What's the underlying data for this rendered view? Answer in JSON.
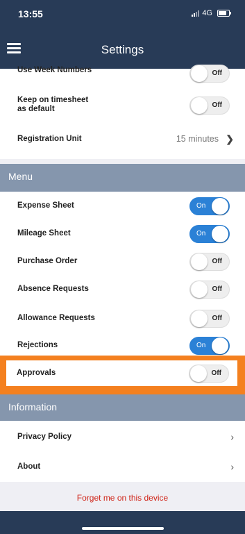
{
  "status_bar": {
    "time": "13:55",
    "network": "4G"
  },
  "navbar": {
    "title": "Settings"
  },
  "general": {
    "use_week_numbers": {
      "label": "Use Week Numbers",
      "state": "Off"
    },
    "keep_on_timesheet": {
      "label": "Keep on timesheet\nas default",
      "state": "Off"
    },
    "registration_unit": {
      "label": "Registration Unit",
      "value": "15 minutes"
    }
  },
  "menu": {
    "title": "Menu",
    "items": [
      {
        "label": "Expense Sheet",
        "state": "On"
      },
      {
        "label": "Mileage Sheet",
        "state": "On"
      },
      {
        "label": "Purchase Order",
        "state": "Off"
      },
      {
        "label": "Absence Requests",
        "state": "Off"
      },
      {
        "label": "Allowance Requests",
        "state": "Off"
      },
      {
        "label": "Rejections",
        "state": "On"
      },
      {
        "label": "Approvals",
        "state": "Off"
      }
    ]
  },
  "information": {
    "title": "Information",
    "items": [
      {
        "label": "Privacy Policy"
      },
      {
        "label": "About"
      }
    ]
  },
  "forget_me": "Forget me on this device",
  "colors": {
    "navbar": "#283b57",
    "section": "#8596ad",
    "toggle_on": "#2b81d6",
    "highlight": "#f4801f",
    "forget": "#d0271b"
  }
}
